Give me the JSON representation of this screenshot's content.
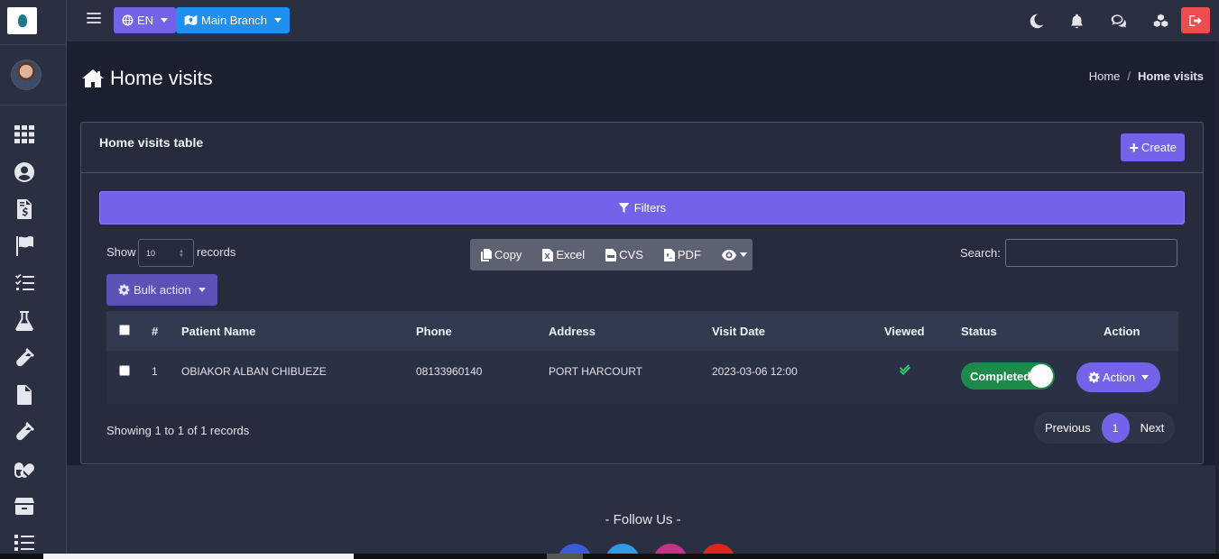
{
  "topbar": {
    "lang_label": "EN",
    "branch_label": "Main Branch"
  },
  "sidebar": {
    "items": [
      {
        "icon": "grid-icon"
      },
      {
        "icon": "user-circle-icon"
      },
      {
        "icon": "invoice-icon"
      },
      {
        "icon": "flag-icon"
      },
      {
        "icon": "checklist-icon"
      },
      {
        "icon": "flask-icon"
      },
      {
        "icon": "test-tube-icon"
      },
      {
        "icon": "file-icon"
      },
      {
        "icon": "vial-icon"
      },
      {
        "icon": "capsules-icon"
      },
      {
        "icon": "box-icon"
      },
      {
        "icon": "list-icon"
      }
    ]
  },
  "page": {
    "title": "Home visits",
    "breadcrumb_home": "Home",
    "breadcrumb_current": "Home visits"
  },
  "card": {
    "title": "Home visits table",
    "create_label": "Create",
    "filters_label": "Filters",
    "show_label": "Show",
    "page_size": "10",
    "records_label": "records",
    "export": {
      "copy": "Copy",
      "excel": "Excel",
      "csv": "CVS",
      "pdf": "PDF"
    },
    "search_label": "Search:",
    "search_value": "",
    "bulk_action_label": "Bulk action"
  },
  "table": {
    "columns": {
      "index": "#",
      "patient_name": "Patient Name",
      "phone": "Phone",
      "address": "Address",
      "visit_date": "Visit Date",
      "viewed": "Viewed",
      "status": "Status",
      "action": "Action"
    },
    "rows": [
      {
        "index": "1",
        "patient_name": "OBIAKOR ALBAN CHIBUEZE",
        "phone": "08133960140",
        "address": "PORT HARCOURT",
        "visit_date": "2023-03-06 12:00",
        "viewed": true,
        "status": "Completed",
        "action_label": "Action"
      }
    ]
  },
  "pagination": {
    "showing": "Showing 1 to 1 of 1 records",
    "previous": "Previous",
    "current": "1",
    "next": "Next"
  },
  "footer": {
    "follow_us": "- Follow Us -",
    "social": [
      {
        "icon": "facebook-icon",
        "color": "#3b5bdb"
      },
      {
        "icon": "twitter-icon",
        "color": "#2f9be8"
      },
      {
        "icon": "instagram-icon",
        "color": "#c13584"
      },
      {
        "icon": "youtube-icon",
        "color": "#e02424"
      }
    ]
  },
  "colors": {
    "accent": "#7263e8",
    "branch": "#1f8ff0",
    "logout": "#ef4c52",
    "status_completed": "#1d8a4a"
  }
}
